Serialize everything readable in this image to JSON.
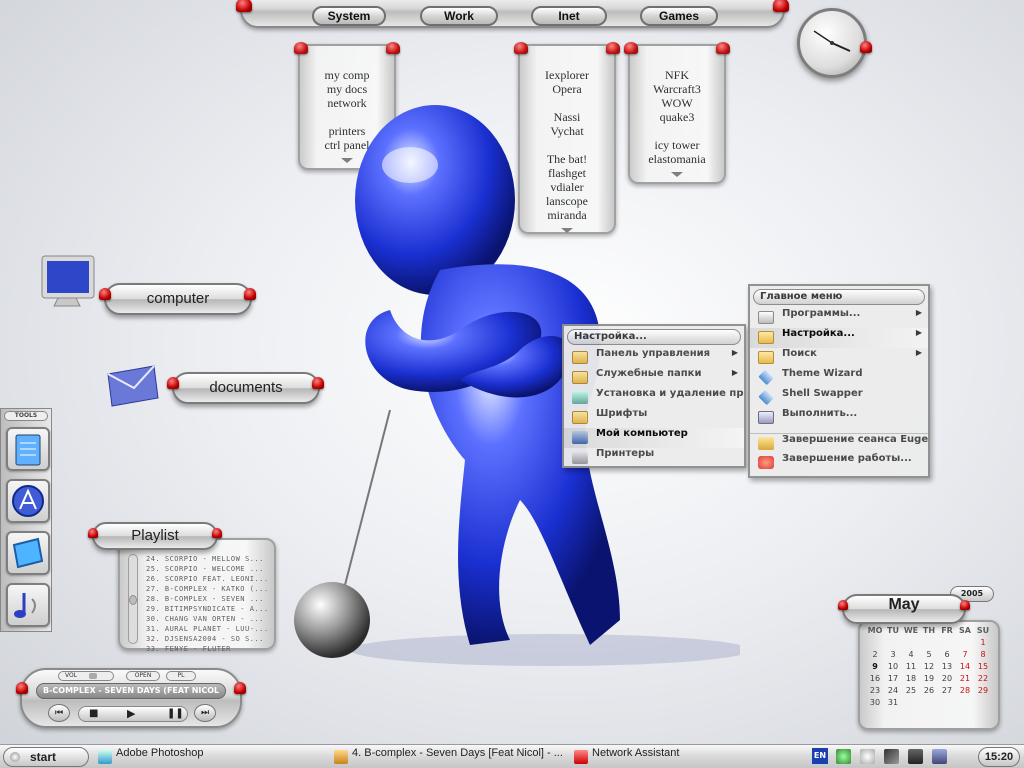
{
  "top_menu": {
    "system": "System",
    "work": "Work",
    "inet": "Inet",
    "games": "Games"
  },
  "system_panel": {
    "items": [
      "my comp",
      "my docs",
      "network",
      "printers",
      "ctrl panel"
    ]
  },
  "work_panel": {
    "items": [
      "Iexplorer",
      "Opera",
      "Nassi",
      "Vychat",
      "The bat!",
      "flashget",
      "vdialer",
      "lanscope",
      "miranda"
    ]
  },
  "games_panel": {
    "items": [
      "NFK",
      "Warcraft3",
      "WOW",
      "quake3",
      "icy tower",
      "elastomania"
    ]
  },
  "desktop": {
    "computer": "computer",
    "documents": "documents"
  },
  "tools": {
    "label": "TOOLS"
  },
  "start_menu": {
    "title": "Главное меню",
    "items": [
      "Программы...",
      "Настройка...",
      "Поиск",
      "Theme Wizard",
      "Shell Swapper",
      "Выполнить...",
      "Завершение сеанса Eugeny...",
      "Завершение работы..."
    ]
  },
  "settings_menu": {
    "title": "Настройка...",
    "items": [
      "Панель управления",
      "Служебные папки",
      "Установка и удаление про...",
      "Шрифты",
      "Мой компьютер",
      "Принтеры"
    ]
  },
  "playlist": {
    "title": "Playlist",
    "tracks": [
      "24. SCORPIO - MELLOW S...",
      "25. SCORPIO - WELCOME ...",
      "26. SCORPIO FEAT. LEONI...",
      "27. B-COMPLEX - KATKO (...",
      "28. B-COMPLEX - SEVEN ...",
      "29. BITIMPSYNDICATE - A...",
      "30. CHANG VAN ORTEN - ...",
      "31. AURAL PLANET - LUU-...",
      "32. DJSENSA2004 - SO S...",
      "33. FENYE - FLUTER"
    ]
  },
  "player": {
    "vol": "VOL",
    "open": "OPEN",
    "pl": "PL",
    "now_playing": "B-COMPLEX - SEVEN DAYS (FEAT NICOL"
  },
  "calendar": {
    "month": "May",
    "year": "2005",
    "days_header": [
      "MO",
      "TU",
      "WE",
      "TH",
      "FR",
      "SA",
      "SU"
    ],
    "weeks": [
      [
        "",
        "",
        "",
        "",
        "",
        "",
        "1"
      ],
      [
        "2",
        "3",
        "4",
        "5",
        "6",
        "7",
        "8"
      ],
      [
        "9",
        "10",
        "11",
        "12",
        "13",
        "14",
        "15"
      ],
      [
        "16",
        "17",
        "18",
        "19",
        "20",
        "21",
        "22"
      ],
      [
        "23",
        "24",
        "25",
        "26",
        "27",
        "28",
        "29"
      ],
      [
        "30",
        "31",
        "",
        "",
        "",
        "",
        ""
      ]
    ]
  },
  "taskbar": {
    "start": "start",
    "tasks": [
      "Adobe Photoshop",
      "4. B-complex - Seven Days [Feat Nicol] - ...",
      "Network Assistant"
    ],
    "lang": "EN",
    "time": "15:20"
  },
  "colors": {
    "accent_red": "#c00000",
    "robot_blue": "#1a2fd0"
  }
}
